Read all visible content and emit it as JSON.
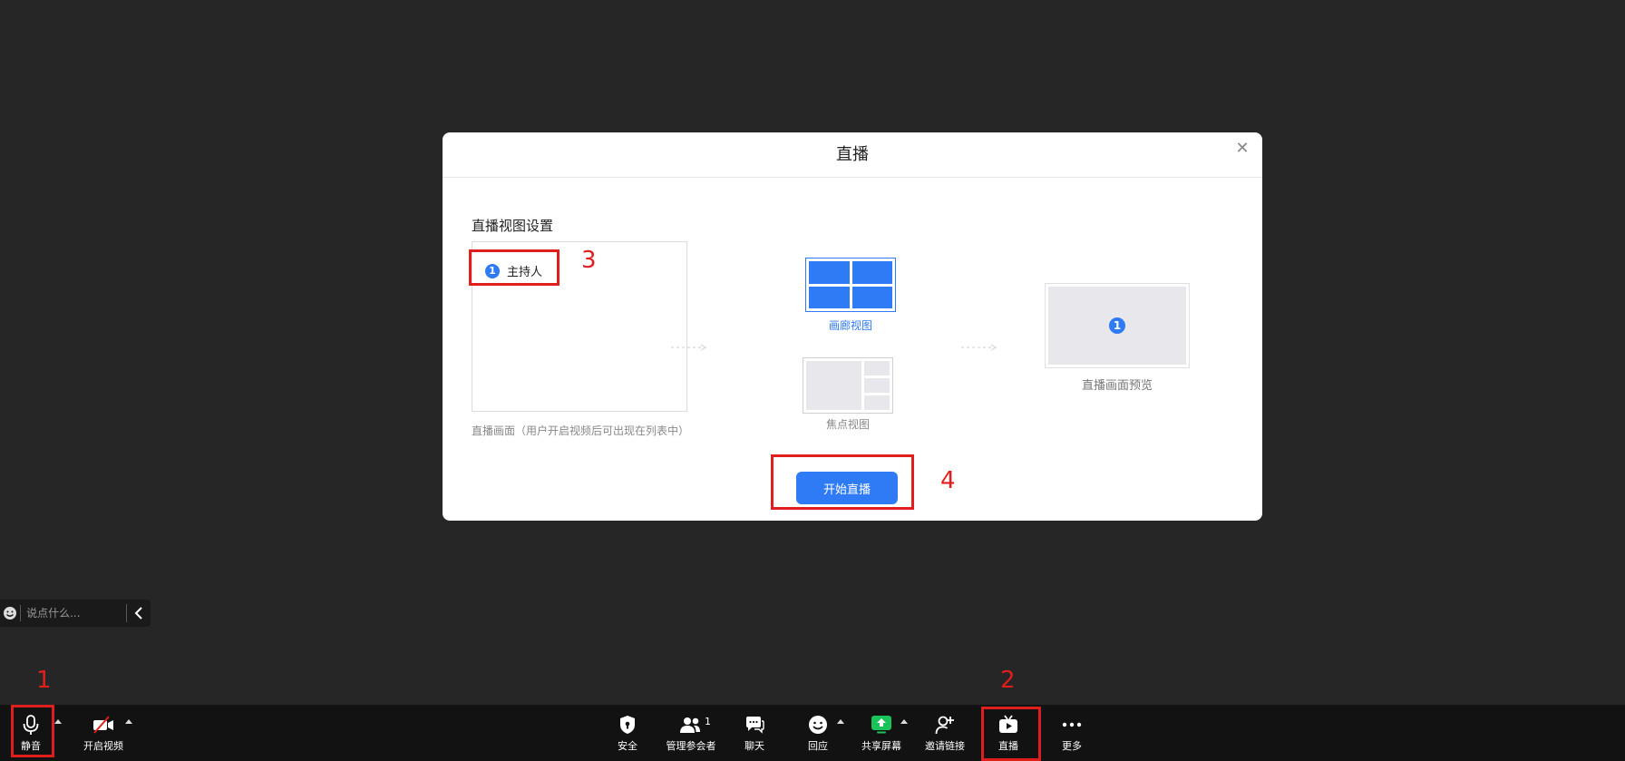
{
  "dialog": {
    "title": "直播",
    "section_title": "直播视图设置",
    "host": {
      "number": "1",
      "label": "主持人"
    },
    "panel_caption": "直播画面（用户开启视频后可出现在列表中）",
    "views": {
      "gallery_label": "画廊视图",
      "focus_label": "焦点视图"
    },
    "preview": {
      "number": "1",
      "label": "直播画面预览"
    },
    "start_button": "开始直播"
  },
  "chat": {
    "placeholder": "说点什么..."
  },
  "toolbar": {
    "mute": "静音",
    "video": "开启视频",
    "security": "安全",
    "participants": "管理参会者",
    "participants_count": "1",
    "chat": "聊天",
    "reactions": "回应",
    "share": "共享屏幕",
    "invite": "邀请链接",
    "live": "直播",
    "more": "更多"
  },
  "annotations": {
    "n1": "1",
    "n2": "2",
    "n3": "3",
    "n4": "4"
  },
  "colors": {
    "accent": "#2f7bf5",
    "annotation": "#e01e1e",
    "share_green": "#1bc45b",
    "toolbar_bg": "#121212",
    "page_bg": "#262626"
  }
}
